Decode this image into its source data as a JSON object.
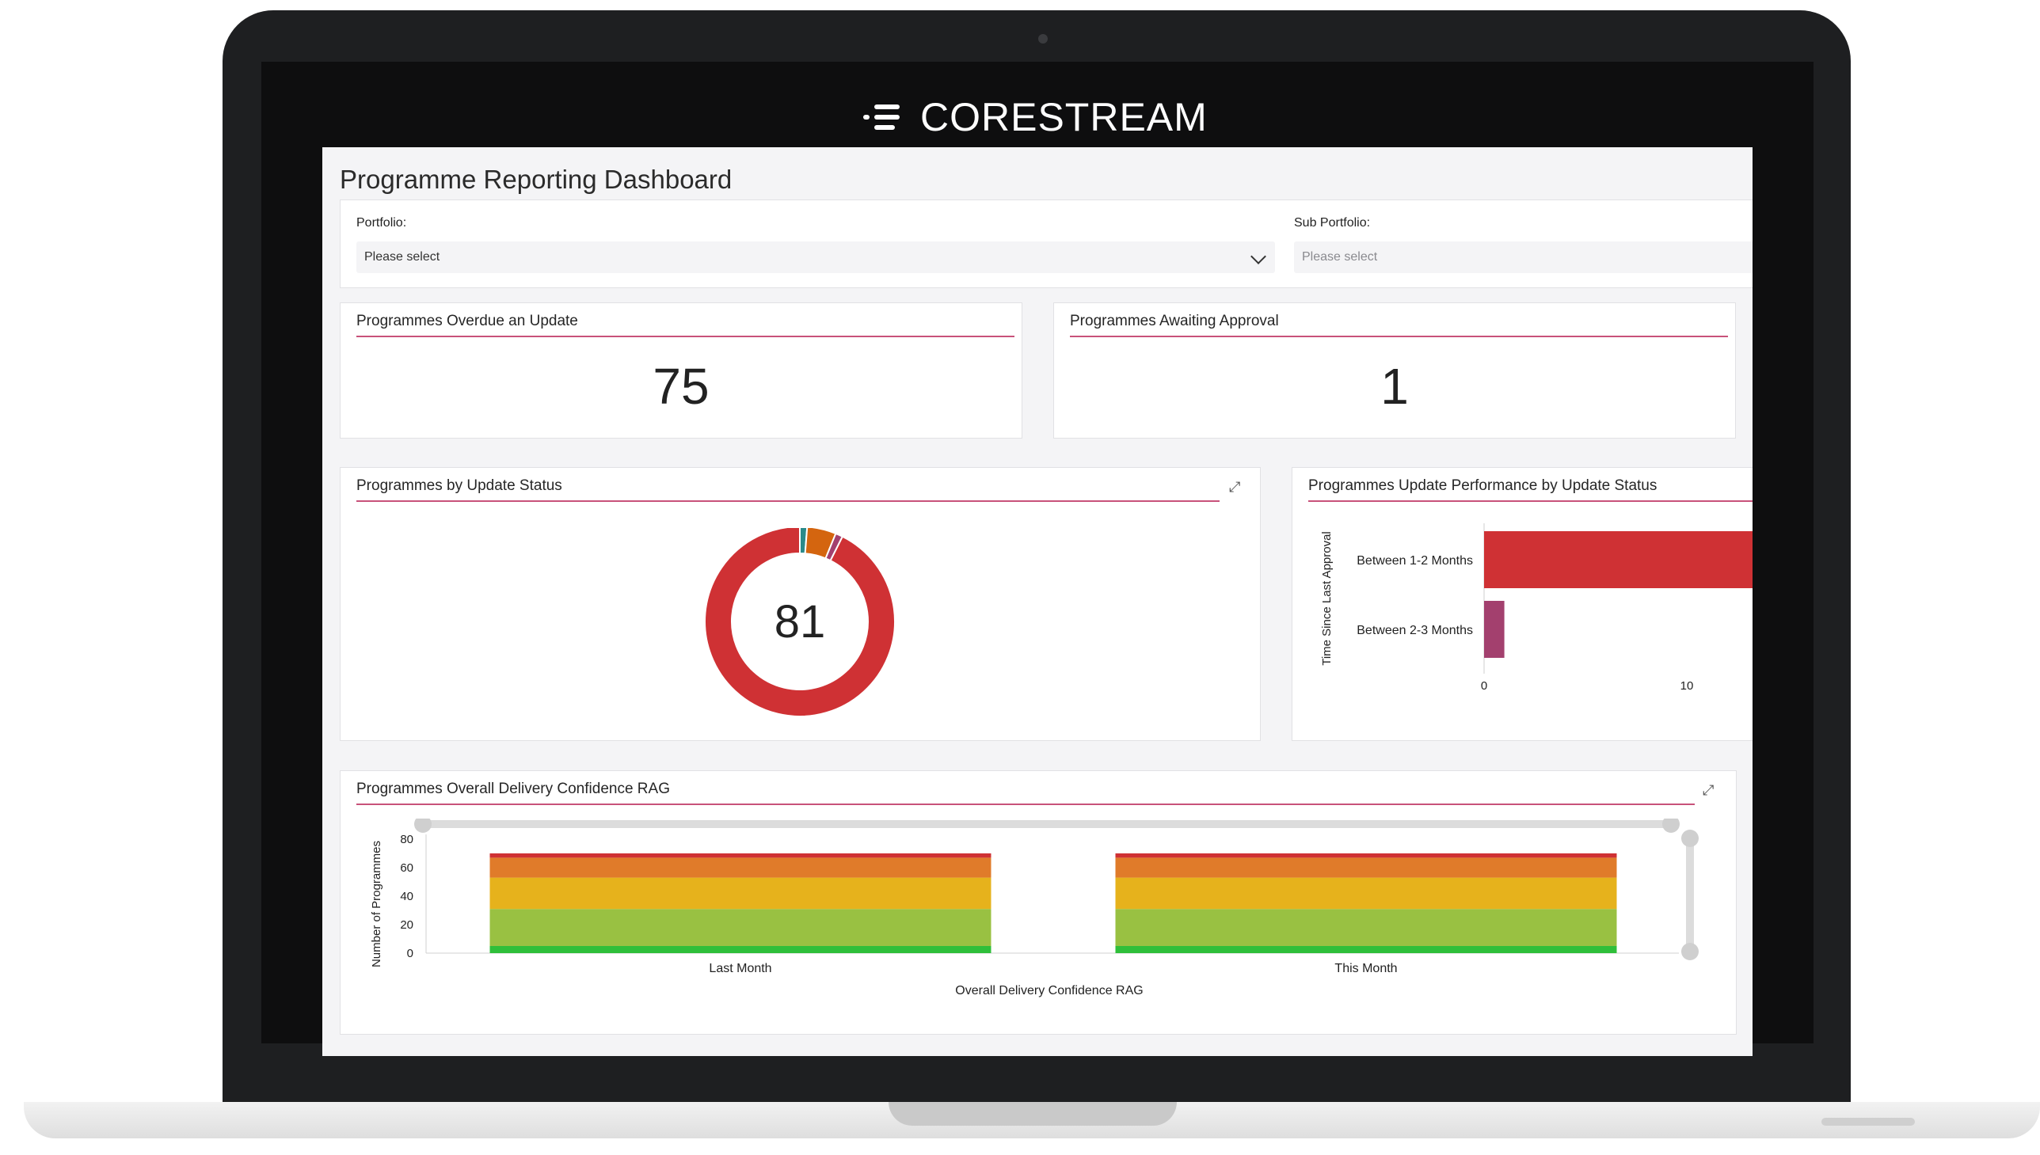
{
  "brand": {
    "name": "CORESTREAM"
  },
  "page": {
    "title": "Programme Reporting Dashboard"
  },
  "filters": {
    "portfolio": {
      "label": "Portfolio:",
      "value": "Please select"
    },
    "sub_portfolio": {
      "label": "Sub Portfolio:",
      "placeholder": "Please select"
    }
  },
  "kpis": {
    "overdue": {
      "title": "Programmes Overdue an Update",
      "value": "75"
    },
    "awaiting": {
      "title": "Programmes Awaiting Approval",
      "value": "1"
    }
  },
  "donut": {
    "title": "Programmes by Update Status",
    "total": "81"
  },
  "performance": {
    "title": "Programmes Update Performance by Update Status"
  },
  "rag": {
    "title": "Programmes Overall Delivery Confidence RAG"
  },
  "colors": {
    "accent_rule": "#c8527a",
    "red": "#cf3134",
    "orange": "#e07b2a",
    "amber": "#e6b21c",
    "light_green": "#99c142",
    "green": "#2fbf3a",
    "teal": "#2a8a8a",
    "burnt_orange": "#d4650f",
    "plum": "#a3406e"
  },
  "chart_data": [
    {
      "type": "pie",
      "variant": "donut",
      "labels": [],
      "values": [
        75,
        1,
        4,
        1
      ],
      "colors": [
        "#cf3134",
        "#2a8a8a",
        "#d4650f",
        "#a3406e"
      ],
      "center_label": "81"
    },
    {
      "type": "bar",
      "orientation": "horizontal",
      "categories": [
        "Between 1-2 Months",
        "Between 2-3 Months"
      ],
      "values": [
        15,
        1
      ],
      "colors": [
        "#cf3134",
        "#a3406e"
      ],
      "ylabel": "Time Since Last Approval",
      "xticks": [
        "0",
        "10"
      ],
      "xlim": [
        0,
        15
      ]
    },
    {
      "type": "bar",
      "stacked": true,
      "categories": [
        "Last Month",
        "This Month"
      ],
      "series": [
        {
          "color": "#2fbf3a",
          "values": [
            5,
            5
          ]
        },
        {
          "color": "#99c142",
          "values": [
            26,
            26
          ]
        },
        {
          "color": "#e6b21c",
          "values": [
            22,
            22
          ]
        },
        {
          "color": "#e07b2a",
          "values": [
            14,
            14
          ]
        },
        {
          "color": "#cf3134",
          "values": [
            3,
            3
          ]
        }
      ],
      "xlabel": "Overall Delivery Confidence RAG",
      "ylabel": "Number of Programmes",
      "yticks": [
        "0",
        "20",
        "40",
        "60",
        "80"
      ],
      "ylim": [
        0,
        80
      ]
    }
  ]
}
